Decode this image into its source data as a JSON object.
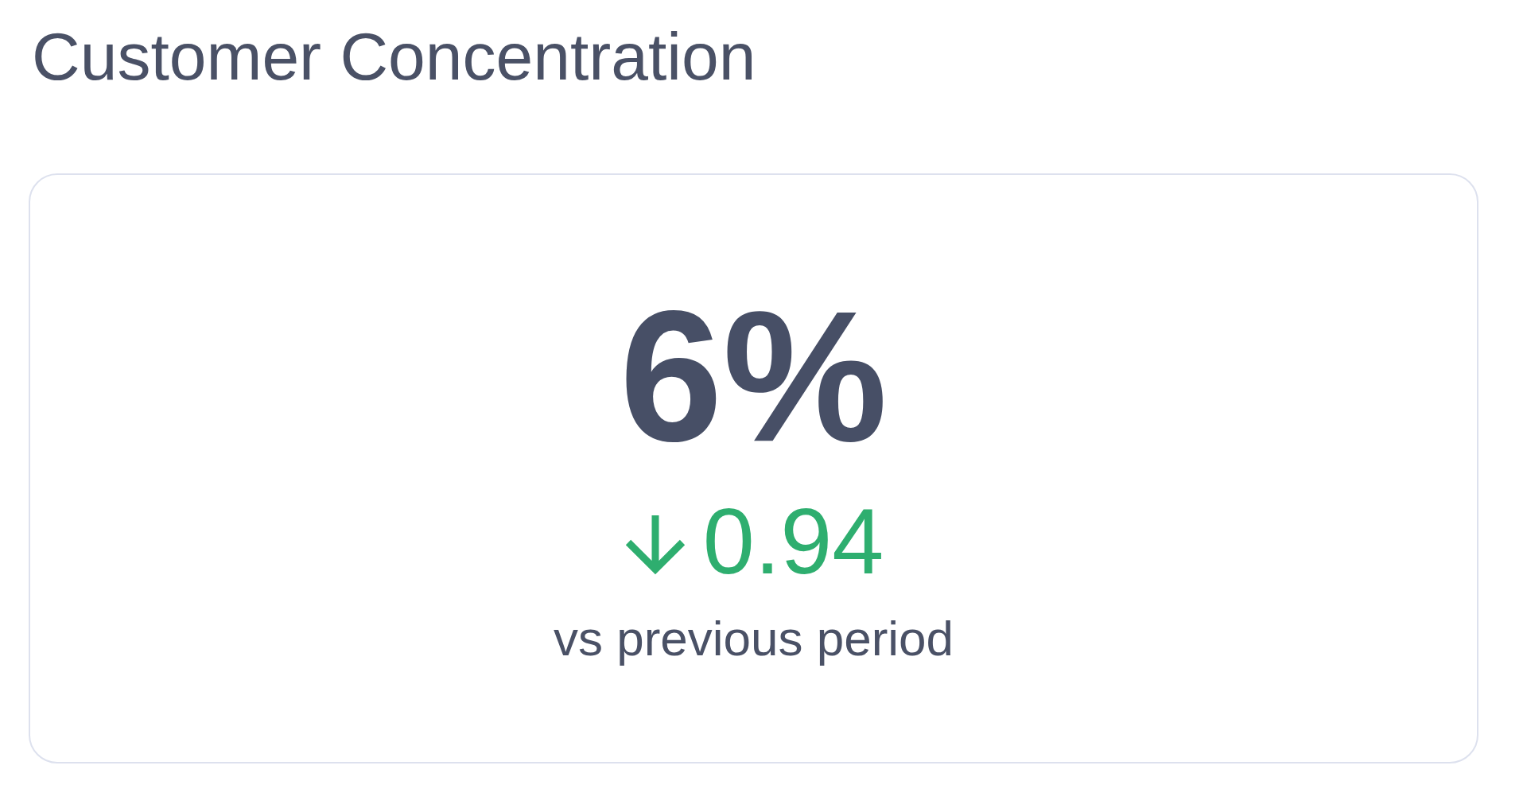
{
  "widget": {
    "title": "Customer Concentration",
    "card": {
      "value": "6%",
      "delta": {
        "rising": false,
        "good": true,
        "value": "0.94"
      },
      "caption": "vs previous period"
    }
  }
}
